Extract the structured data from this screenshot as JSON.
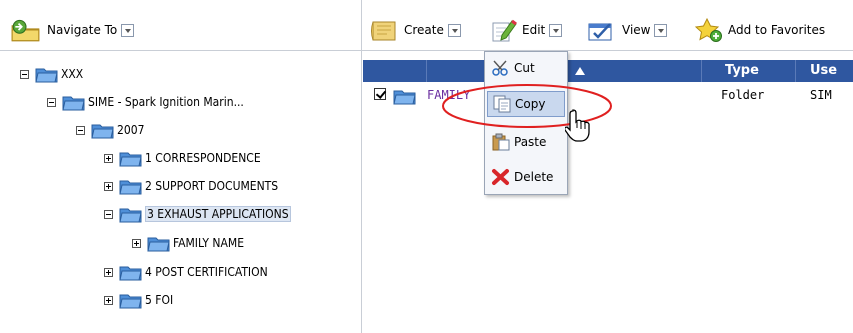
{
  "toolbar": {
    "navigate_label": "Navigate To",
    "create_label": "Create",
    "edit_label": "Edit",
    "view_label": "View",
    "favorites_label": "Add to Favorites"
  },
  "tree": [
    {
      "label": "XXX"
    },
    {
      "label": "SIME - Spark Ignition Marin..."
    },
    {
      "label": "2007"
    },
    {
      "label": "1 CORRESPONDENCE"
    },
    {
      "label": "2 SUPPORT DOCUMENTS"
    },
    {
      "label": "3 EXHAUST APPLICATIONS"
    },
    {
      "label": "FAMILY NAME"
    },
    {
      "label": "4 POST CERTIFICATION"
    },
    {
      "label": "5 FOI"
    }
  ],
  "grid": {
    "headers": [
      "Type",
      "Use"
    ],
    "rows": [
      {
        "name": "FAMILY",
        "type": "Folder",
        "user": "SIM"
      }
    ]
  },
  "edit_menu": {
    "items": [
      {
        "label": "Cut"
      },
      {
        "label": "Copy"
      },
      {
        "label": "Paste"
      },
      {
        "label": "Delete"
      }
    ]
  },
  "colors": {
    "header_blue": "#2f57a0",
    "folder_name_purple": "#6a2fa0",
    "annotation_red": "#e02020",
    "menu_highlight": "#c9d8ee"
  },
  "icons": {
    "navigate": "navigate-folder-icon",
    "create": "create-folder-icon",
    "edit": "edit-pencil-icon",
    "view": "view-check-icon",
    "favorites": "star-add-icon",
    "cut": "scissors-icon",
    "copy": "copy-icon",
    "paste": "paste-icon",
    "delete": "delete-x-icon"
  }
}
